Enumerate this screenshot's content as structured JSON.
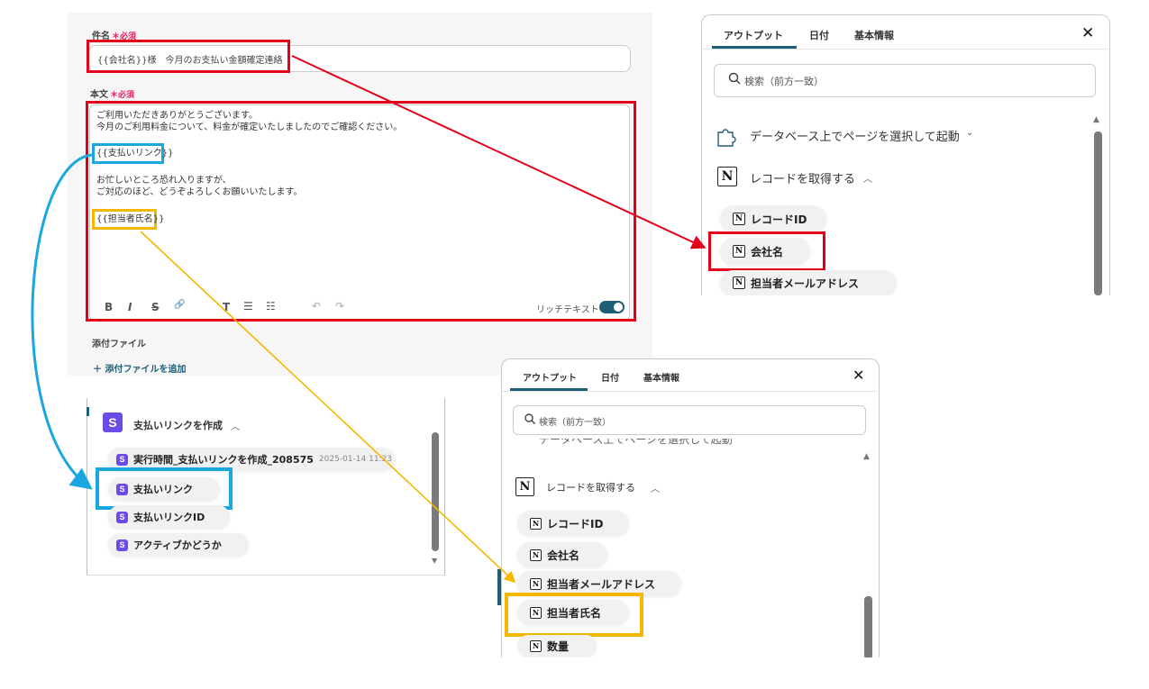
{
  "form": {
    "subject_label": "件名",
    "required": "必須",
    "subject_value": "{{会社名}}様　今月のお支払い金額確定連絡",
    "body_label": "本文",
    "body_lines": [
      "ご利用いただきありがとうございます。",
      "今月のご利用料金について、料金が確定いたしましたのでご確認ください。",
      "{{支払いリンク}}",
      "お忙しいところ恐れ入りますが、",
      "ご対応のほど、どうぞよろしくお願いいたします。",
      "{{担当者氏名}}"
    ],
    "toolbar": {
      "bold": "B",
      "italic": "I",
      "strike": "S",
      "link": "🔗",
      "clear": "T",
      "ul": "☰",
      "ol": "☷",
      "undo": "↶",
      "redo": "↷"
    },
    "rich_text_label": "リッチテキスト",
    "attach_label": "添付ファイル",
    "add_attach": "＋ 添付ファイルを追加"
  },
  "panel_top": {
    "tabs": [
      "アウトプット",
      "日付",
      "基本情報"
    ],
    "close": "✕",
    "search_placeholder": "検索（前方一致）",
    "trigger_section": "データベース上でページを選択して起動",
    "record_section": "レコードを取得する",
    "items": [
      "レコードID",
      "会社名",
      "担当者メールアドレス"
    ]
  },
  "panel_stripe": {
    "section": "支払いリンクを作成",
    "items": [
      {
        "label": "実行時間_支払いリンクを作成_208575",
        "meta": "2025-01-14 11:23"
      },
      {
        "label": "支払いリンク",
        "meta": ""
      },
      {
        "label": "支払いリンクID",
        "meta": ""
      },
      {
        "label": "アクティブかどうか",
        "meta": ""
      }
    ]
  },
  "panel_bottom": {
    "tabs": [
      "アウトプット",
      "日付",
      "基本情報"
    ],
    "close": "✕",
    "search_placeholder": "検索（前方一致）",
    "trigger_section": "データベース上でページを選択して起動",
    "record_section": "レコードを取得する",
    "items": [
      "レコードID",
      "会社名",
      "担当者メールアドレス",
      "担当者氏名",
      "数量"
    ]
  },
  "colors": {
    "red": "#e4001b",
    "blue": "#1aa6e0",
    "yellow": "#f5b700",
    "accent": "#1e5f78"
  },
  "icons": {
    "search": "search-icon",
    "notion": "notion-icon",
    "stripe": "stripe-icon",
    "puzzle": "puzzle-icon"
  }
}
